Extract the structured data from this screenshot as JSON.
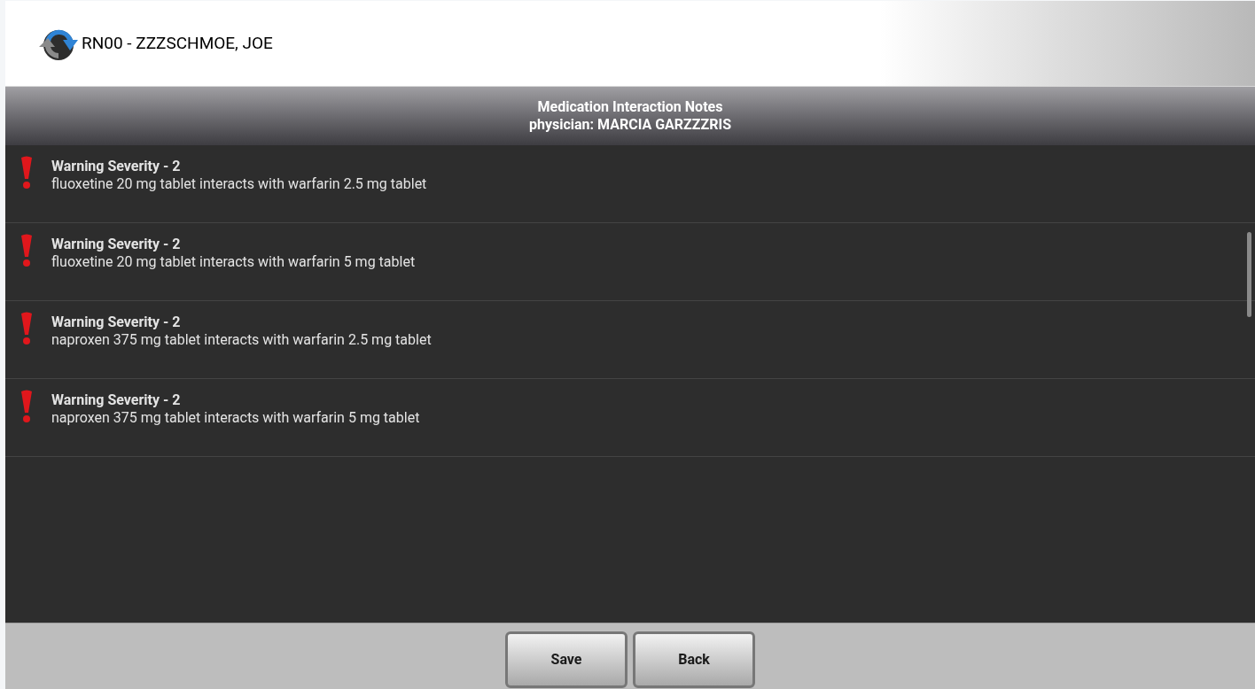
{
  "header": {
    "patient": "RN00 - ZZZSCHMOE, JOE"
  },
  "title_bar": {
    "title": "Medication Interaction Notes",
    "physician": "physician: MARCIA GARZZZRIS"
  },
  "interactions": [
    {
      "severity": "Warning Severity - 2",
      "description": "fluoxetine 20 mg tablet interacts with warfarin 2.5 mg tablet"
    },
    {
      "severity": "Warning Severity - 2",
      "description": "fluoxetine 20 mg tablet interacts with warfarin 5 mg tablet"
    },
    {
      "severity": "Warning Severity - 2",
      "description": "naproxen 375 mg tablet interacts with warfarin 2.5 mg tablet"
    },
    {
      "severity": "Warning Severity - 2",
      "description": "naproxen 375 mg tablet interacts with warfarin 5 mg tablet"
    }
  ],
  "buttons": [
    "Save",
    "Back"
  ]
}
